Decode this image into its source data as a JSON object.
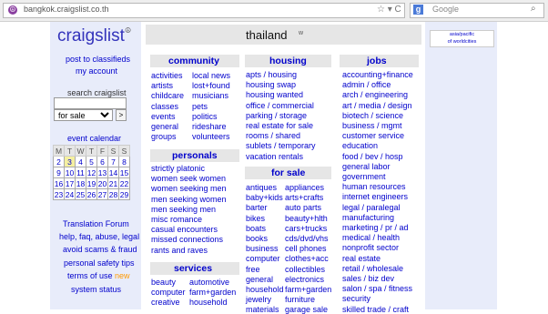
{
  "browser": {
    "url": "bangkok.craigslist.co.th",
    "search_placeholder": "Google"
  },
  "left": {
    "logo": "craigslist",
    "logo_mark": "☮",
    "post": "post to classifieds",
    "account": "my account",
    "search_label": "search craigslist",
    "search_value": "",
    "search_category": "for sale",
    "go": ">",
    "calendar_title": "event calendar",
    "weekdays": [
      "M",
      "T",
      "W",
      "T",
      "F",
      "S",
      "S"
    ],
    "weeks": [
      [
        "2",
        "3",
        "4",
        "5",
        "6",
        "7",
        "8"
      ],
      [
        "9",
        "10",
        "11",
        "12",
        "13",
        "14",
        "15"
      ],
      [
        "16",
        "17",
        "18",
        "19",
        "20",
        "21",
        "22"
      ],
      [
        "23",
        "24",
        "25",
        "26",
        "27",
        "28",
        "29"
      ]
    ],
    "today": "3",
    "translation": "Translation Forum",
    "help": "help, faq, abuse, legal",
    "scams": "avoid scams & fraud",
    "safety": "personal safety tips",
    "terms": "terms of use",
    "new_badge": "new",
    "status": "system status"
  },
  "header": {
    "city": "thailand",
    "city_arrow": "w"
  },
  "right": {
    "line1": "asia/pacific",
    "line2": "of worldcities"
  },
  "community": {
    "title": "community",
    "col1": [
      "activities",
      "artists",
      "childcare",
      "classes",
      "events",
      "general",
      "groups"
    ],
    "col2": [
      "local news",
      "lost+found",
      "musicians",
      "pets",
      "politics",
      "rideshare",
      "volunteers"
    ]
  },
  "personals": {
    "title": "personals",
    "items": [
      "strictly platonic",
      "women seek women",
      "women seeking men",
      "men seeking women",
      "men seeking men",
      "misc romance",
      "casual encounters",
      "missed connections",
      "rants and raves"
    ]
  },
  "services": {
    "title": "services",
    "col1": [
      "beauty",
      "computer",
      "creative"
    ],
    "col2": [
      "automotive",
      "farm+garden",
      "household"
    ]
  },
  "housing": {
    "title": "housing",
    "items": [
      "apts / housing",
      "housing swap",
      "housing wanted",
      "office / commercial",
      "parking / storage",
      "real estate for sale",
      "rooms / shared",
      "sublets / temporary",
      "vacation rentals"
    ]
  },
  "forsale": {
    "title": "for sale",
    "col1": [
      "antiques",
      "baby+kids",
      "barter",
      "bikes",
      "boats",
      "books",
      "business",
      "computer",
      "free",
      "general",
      "household",
      "jewelry",
      "materials"
    ],
    "col2": [
      "appliances",
      "arts+crafts",
      "auto parts",
      "beauty+hlth",
      "cars+trucks",
      "cds/dvd/vhs",
      "cell phones",
      "clothes+acc",
      "collectibles",
      "electronics",
      "farm+garden",
      "furniture",
      "garage sale"
    ]
  },
  "jobs": {
    "title": "jobs",
    "items": [
      "accounting+finance",
      "admin / office",
      "arch / engineering",
      "art / media / design",
      "biotech / science",
      "business / mgmt",
      "customer service",
      "education",
      "food / bev / hosp",
      "general labor",
      "government",
      "human resources",
      "internet engineers",
      "legal / paralegal",
      "manufacturing",
      "marketing / pr / ad",
      "medical / health",
      "nonprofit sector",
      "real estate",
      "retail / wholesale",
      "sales / biz dev",
      "salon / spa / fitness",
      "security",
      "skilled trade / craft"
    ]
  }
}
